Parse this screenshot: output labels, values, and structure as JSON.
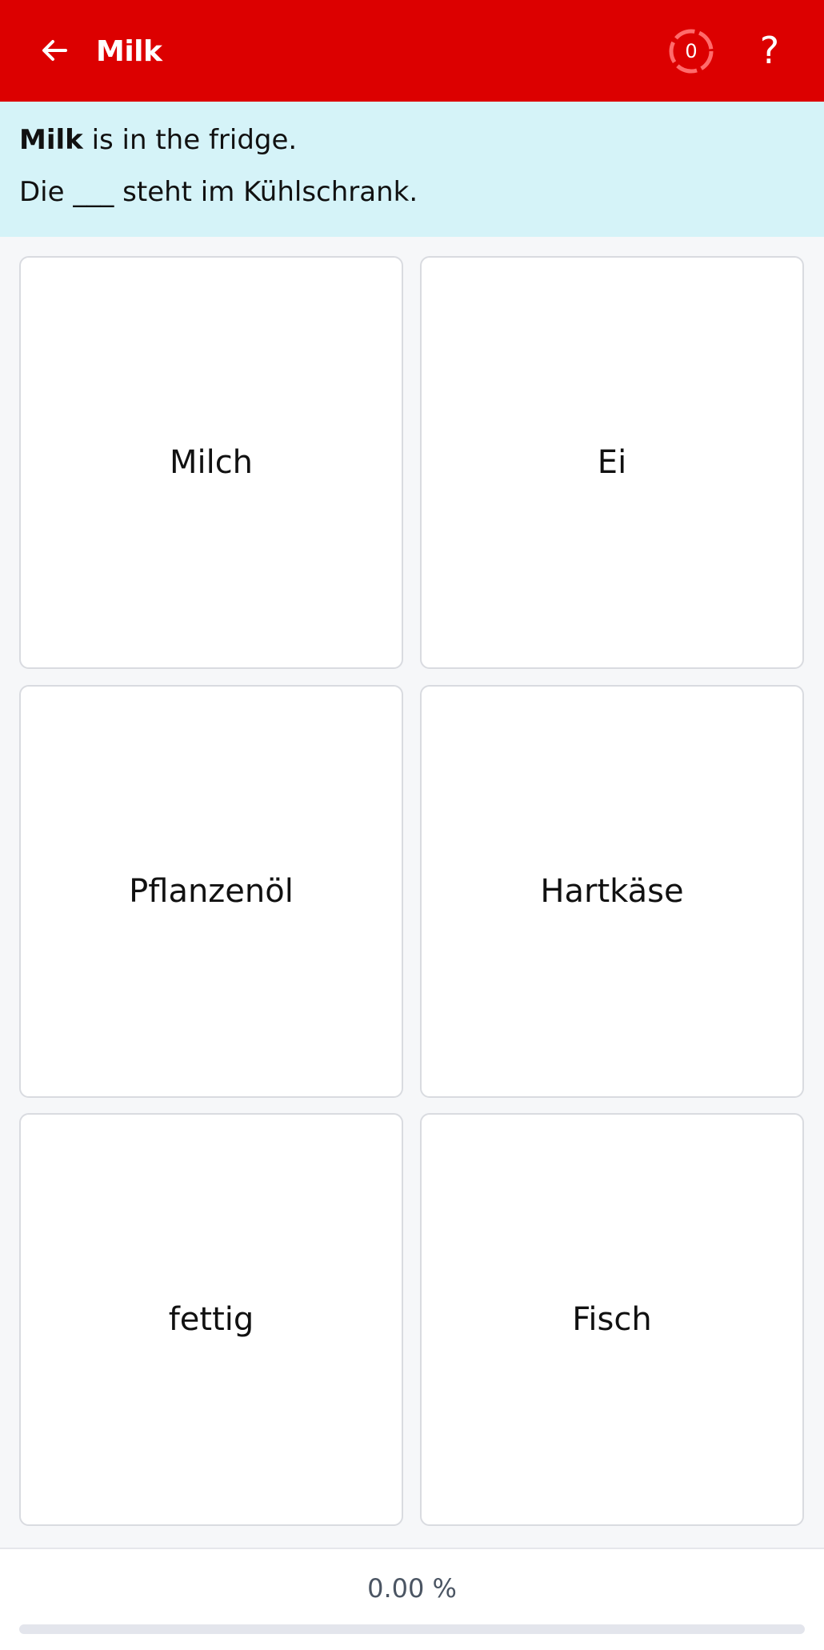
{
  "header": {
    "title": "Milk",
    "counter": "0",
    "help": "?",
    "colors": {
      "bar": "#dc0000",
      "text": "#ffffff"
    },
    "icons": {
      "back": "arrow-left-icon",
      "counter": "dashed-ring-icon",
      "help": "question-mark-icon"
    }
  },
  "prompt": {
    "bold": "Milk",
    "rest": " is in the fridge.",
    "sentence": "Die ___ steht im Kühlschrank.",
    "background": "#d5f3f8"
  },
  "options": [
    "Milch",
    "Ei",
    "Pflanzenöl",
    "Hartkäse",
    "fettig",
    "Fisch"
  ],
  "progress": {
    "label": "0.00 %",
    "value": 0
  }
}
